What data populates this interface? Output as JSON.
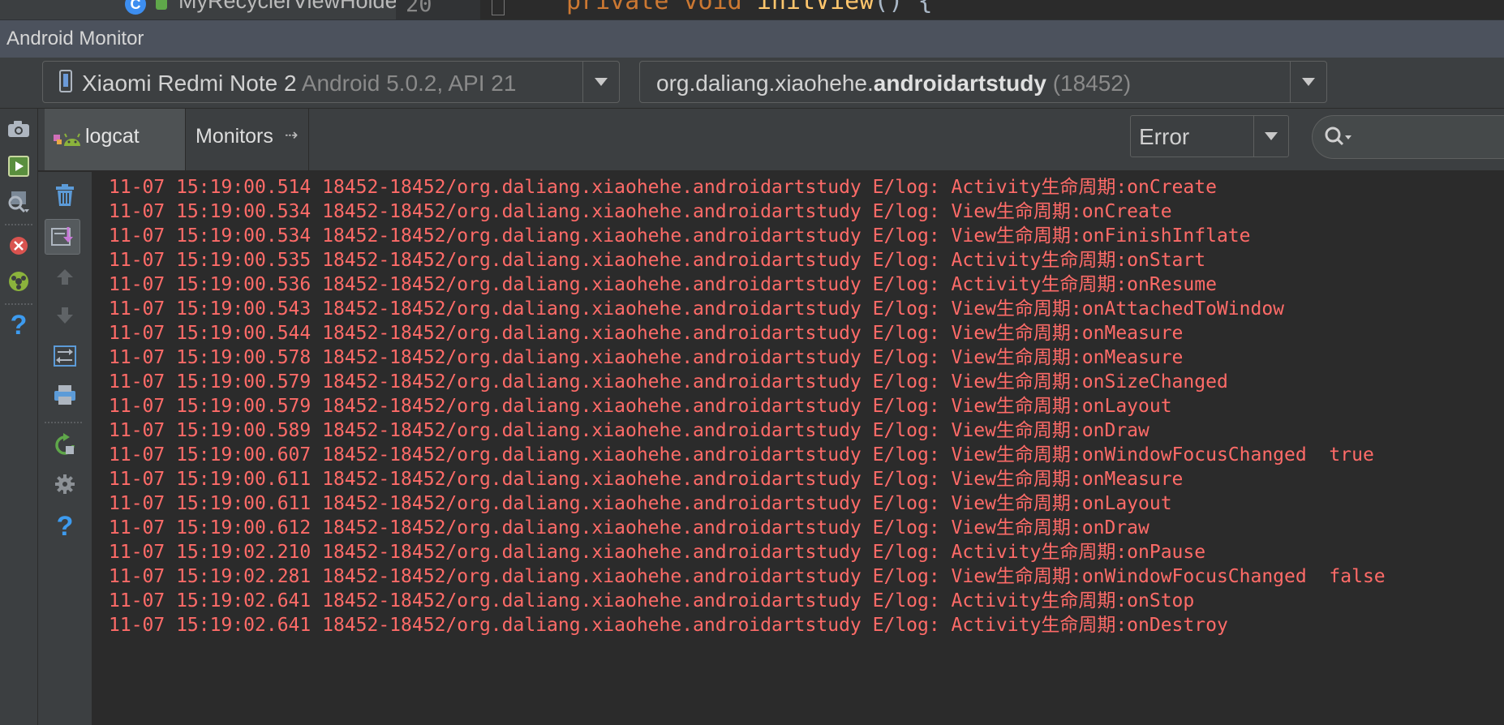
{
  "editor": {
    "tree_item": "MyRecyclerViewHolder",
    "line_number": "20",
    "code_keyword": "private void",
    "code_method": "initView",
    "code_tail": "() {"
  },
  "window": {
    "title": "Android Monitor"
  },
  "device": {
    "name": "Xiaomi Redmi Note 2",
    "os": "Android 5.0.2, API 21"
  },
  "process": {
    "package_prefix": "org.daliang.xiaohehe.",
    "package_name": "androidartstudy",
    "pid": "(18452)"
  },
  "tabs": [
    {
      "label": "logcat"
    },
    {
      "label": "Monitors"
    }
  ],
  "filter": {
    "level": "Error",
    "search_value": ""
  },
  "colors": {
    "error_text": "#ff6b68",
    "panel_bg": "#3c3f41",
    "log_bg": "#2b2b2b"
  },
  "icons": {
    "outer_toolbar": [
      "camera-icon",
      "screen-record-icon",
      "system-info-icon",
      "terminate-icon",
      "gpu-monitor-icon",
      "help-icon"
    ],
    "inner_toolbar": [
      "clear-logcat-icon",
      "scroll-to-end-icon",
      "up-arrow-icon",
      "down-arrow-icon",
      "soft-wraps-icon",
      "print-icon",
      "restart-icon",
      "settings-icon",
      "help-icon"
    ]
  },
  "logs": [
    "11-07 15:19:00.514 18452-18452/org.daliang.xiaohehe.androidartstudy E/log: Activity生命周期:onCreate",
    "11-07 15:19:00.534 18452-18452/org.daliang.xiaohehe.androidartstudy E/log: View生命周期:onCreate",
    "11-07 15:19:00.534 18452-18452/org.daliang.xiaohehe.androidartstudy E/log: View生命周期:onFinishInflate",
    "11-07 15:19:00.535 18452-18452/org.daliang.xiaohehe.androidartstudy E/log: Activity生命周期:onStart",
    "11-07 15:19:00.536 18452-18452/org.daliang.xiaohehe.androidartstudy E/log: Activity生命周期:onResume",
    "11-07 15:19:00.543 18452-18452/org.daliang.xiaohehe.androidartstudy E/log: View生命周期:onAttachedToWindow",
    "11-07 15:19:00.544 18452-18452/org.daliang.xiaohehe.androidartstudy E/log: View生命周期:onMeasure",
    "11-07 15:19:00.578 18452-18452/org.daliang.xiaohehe.androidartstudy E/log: View生命周期:onMeasure",
    "11-07 15:19:00.579 18452-18452/org.daliang.xiaohehe.androidartstudy E/log: View生命周期:onSizeChanged",
    "11-07 15:19:00.579 18452-18452/org.daliang.xiaohehe.androidartstudy E/log: View生命周期:onLayout",
    "11-07 15:19:00.589 18452-18452/org.daliang.xiaohehe.androidartstudy E/log: View生命周期:onDraw",
    "11-07 15:19:00.607 18452-18452/org.daliang.xiaohehe.androidartstudy E/log: View生命周期:onWindowFocusChanged  true",
    "11-07 15:19:00.611 18452-18452/org.daliang.xiaohehe.androidartstudy E/log: View生命周期:onMeasure",
    "11-07 15:19:00.611 18452-18452/org.daliang.xiaohehe.androidartstudy E/log: View生命周期:onLayout",
    "11-07 15:19:00.612 18452-18452/org.daliang.xiaohehe.androidartstudy E/log: View生命周期:onDraw",
    "11-07 15:19:02.210 18452-18452/org.daliang.xiaohehe.androidartstudy E/log: Activity生命周期:onPause",
    "11-07 15:19:02.281 18452-18452/org.daliang.xiaohehe.androidartstudy E/log: View生命周期:onWindowFocusChanged  false",
    "11-07 15:19:02.641 18452-18452/org.daliang.xiaohehe.androidartstudy E/log: Activity生命周期:onStop",
    "11-07 15:19:02.641 18452-18452/org.daliang.xiaohehe.androidartstudy E/log: Activity生命周期:onDestroy"
  ]
}
